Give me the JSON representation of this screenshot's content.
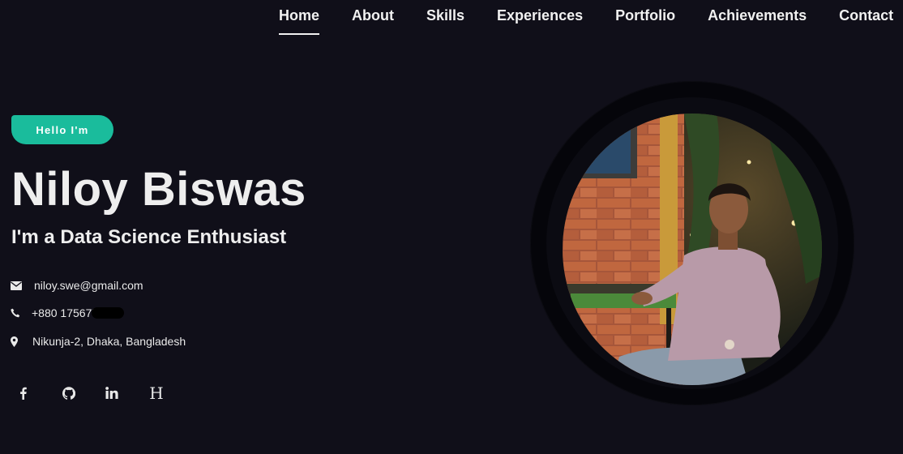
{
  "nav": {
    "items": [
      {
        "label": "Home",
        "active": true
      },
      {
        "label": "About",
        "active": false
      },
      {
        "label": "Skills",
        "active": false
      },
      {
        "label": "Experiences",
        "active": false
      },
      {
        "label": "Portfolio",
        "active": false
      },
      {
        "label": "Achievements",
        "active": false
      },
      {
        "label": "Contact",
        "active": false
      }
    ]
  },
  "hero": {
    "badge": "Hello I'm",
    "name": "Niloy Biswas",
    "tagline": "I'm a Data Science Enthusiast"
  },
  "contact": {
    "email": "niloy.swe@gmail.com",
    "phone": "+880 175677",
    "address": "Nikunja-2, Dhaka, Bangladesh"
  },
  "socials": [
    {
      "icon": "facebook-icon"
    },
    {
      "icon": "github-icon"
    },
    {
      "icon": "linkedin-icon"
    },
    {
      "icon": "hashnode-icon"
    }
  ],
  "colors": {
    "background": "#100f19",
    "accent": "#1abc9c",
    "text": "#eeeeee"
  }
}
